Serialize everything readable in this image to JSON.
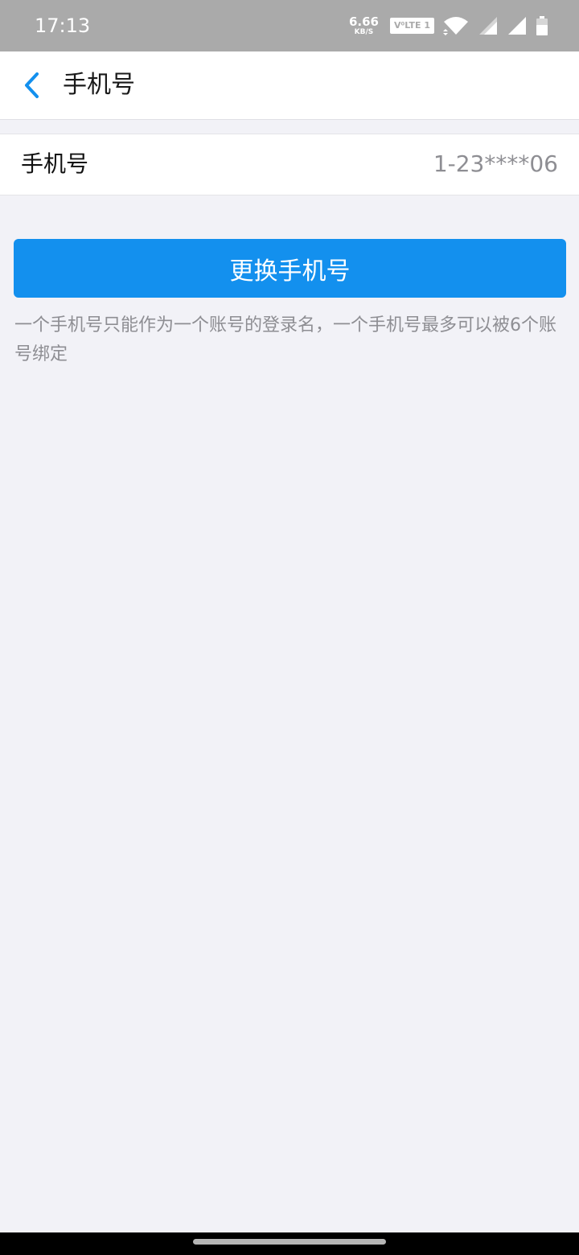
{
  "status_bar": {
    "time": "17:13",
    "net_speed": "6.66",
    "net_speed_unit": "KB/S",
    "volte": "V⁰LTE 1",
    "icons": [
      "wifi-icon",
      "signal-icon",
      "signal-icon",
      "battery-icon"
    ]
  },
  "header": {
    "back_icon": "chevron-left-icon",
    "title": "手机号"
  },
  "phone_row": {
    "label": "手机号",
    "value": "1-23****06"
  },
  "actions": {
    "change_label": "更换手机号"
  },
  "hint": "一个手机号只能作为一个账号的登录名，一个手机号最多可以被6个账号绑定",
  "colors": {
    "accent": "#1390ee",
    "status_bar": "#aaaaaa",
    "background": "#f2f2f7"
  }
}
